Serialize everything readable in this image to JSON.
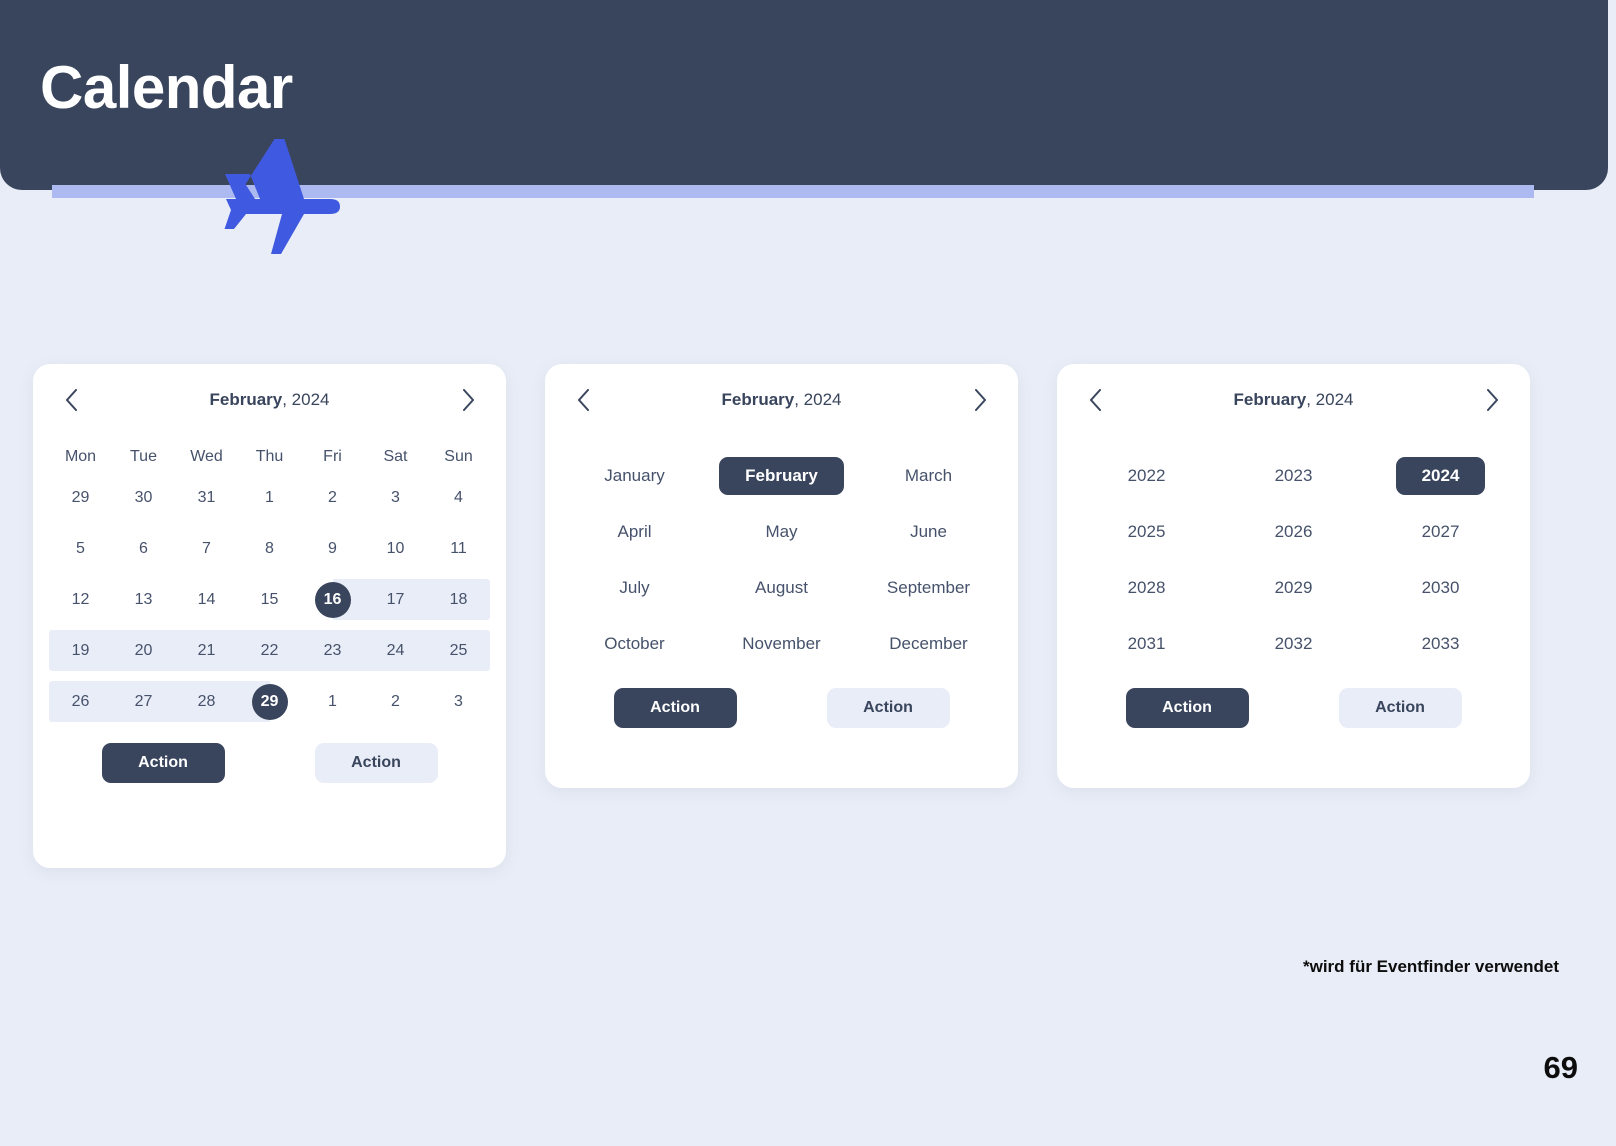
{
  "header": {
    "title": "Calendar",
    "bar_color": "#39455c",
    "accent_color": "#adbaf2",
    "plane_icon": "airplane-icon",
    "plane_color": "#3f5ae0"
  },
  "page": {
    "background": "#e9edf7",
    "footnote": "*wird für Eventfinder verwendet",
    "number": "69"
  },
  "common": {
    "prev_icon": "chevron-left-icon",
    "next_icon": "chevron-right-icon",
    "action_primary_label": "Action",
    "action_secondary_label": "Action",
    "accent_dark": "#39455c",
    "range_fill": "#e9edf7"
  },
  "day_picker": {
    "title_month": "February",
    "title_rest": ", 2024",
    "weekdays": [
      "Mon",
      "Tue",
      "Wed",
      "Thu",
      "Fri",
      "Sat",
      "Sun"
    ],
    "weeks": [
      [
        {
          "label": "29",
          "muted": true,
          "selected": false,
          "range": "none"
        },
        {
          "label": "30",
          "muted": true,
          "selected": false,
          "range": "none"
        },
        {
          "label": "31",
          "muted": true,
          "selected": false,
          "range": "none"
        },
        {
          "label": "1",
          "muted": false,
          "selected": false,
          "range": "none"
        },
        {
          "label": "2",
          "muted": false,
          "selected": false,
          "range": "none"
        },
        {
          "label": "3",
          "muted": false,
          "selected": false,
          "range": "none"
        },
        {
          "label": "4",
          "muted": false,
          "selected": false,
          "range": "none"
        }
      ],
      [
        {
          "label": "5",
          "muted": false,
          "selected": false,
          "range": "none"
        },
        {
          "label": "6",
          "muted": false,
          "selected": false,
          "range": "none"
        },
        {
          "label": "7",
          "muted": false,
          "selected": false,
          "range": "none"
        },
        {
          "label": "8",
          "muted": false,
          "selected": false,
          "range": "none"
        },
        {
          "label": "9",
          "muted": false,
          "selected": false,
          "range": "none"
        },
        {
          "label": "10",
          "muted": false,
          "selected": false,
          "range": "none"
        },
        {
          "label": "11",
          "muted": false,
          "selected": false,
          "range": "none"
        }
      ],
      [
        {
          "label": "12",
          "muted": false,
          "selected": false,
          "range": "none"
        },
        {
          "label": "13",
          "muted": false,
          "selected": false,
          "range": "none"
        },
        {
          "label": "14",
          "muted": false,
          "selected": false,
          "range": "none"
        },
        {
          "label": "15",
          "muted": false,
          "selected": false,
          "range": "none"
        },
        {
          "label": "16",
          "muted": false,
          "selected": true,
          "range": "start"
        },
        {
          "label": "17",
          "muted": false,
          "selected": false,
          "range": "in"
        },
        {
          "label": "18",
          "muted": false,
          "selected": false,
          "range": "in-end-row"
        }
      ],
      [
        {
          "label": "19",
          "muted": false,
          "selected": false,
          "range": "in-start-row"
        },
        {
          "label": "20",
          "muted": false,
          "selected": false,
          "range": "in"
        },
        {
          "label": "21",
          "muted": false,
          "selected": false,
          "range": "in"
        },
        {
          "label": "22",
          "muted": false,
          "selected": false,
          "range": "in"
        },
        {
          "label": "23",
          "muted": false,
          "selected": false,
          "range": "in"
        },
        {
          "label": "24",
          "muted": false,
          "selected": false,
          "range": "in"
        },
        {
          "label": "25",
          "muted": false,
          "selected": false,
          "range": "in-end-row"
        }
      ],
      [
        {
          "label": "26",
          "muted": false,
          "selected": false,
          "range": "in-start-row"
        },
        {
          "label": "27",
          "muted": false,
          "selected": false,
          "range": "in"
        },
        {
          "label": "28",
          "muted": false,
          "selected": false,
          "range": "in"
        },
        {
          "label": "29",
          "muted": false,
          "selected": true,
          "range": "end"
        },
        {
          "label": "1",
          "muted": true,
          "selected": false,
          "range": "none"
        },
        {
          "label": "2",
          "muted": true,
          "selected": false,
          "range": "none"
        },
        {
          "label": "3",
          "muted": true,
          "selected": false,
          "range": "none"
        }
      ]
    ],
    "selected_start": "16",
    "selected_end": "29"
  },
  "month_picker": {
    "title_month": "February",
    "title_rest": ", 2024",
    "months": [
      {
        "label": "January",
        "selected": false
      },
      {
        "label": "February",
        "selected": true
      },
      {
        "label": "March",
        "selected": false
      },
      {
        "label": "April",
        "selected": false
      },
      {
        "label": "May",
        "selected": false
      },
      {
        "label": "June",
        "selected": false
      },
      {
        "label": "July",
        "selected": false
      },
      {
        "label": "August",
        "selected": false
      },
      {
        "label": "September",
        "selected": false
      },
      {
        "label": "October",
        "selected": false
      },
      {
        "label": "November",
        "selected": false
      },
      {
        "label": "December",
        "selected": false
      }
    ]
  },
  "year_picker": {
    "title_month": "February",
    "title_rest": ", 2024",
    "years": [
      {
        "label": "2022",
        "selected": false
      },
      {
        "label": "2023",
        "selected": false
      },
      {
        "label": "2024",
        "selected": true
      },
      {
        "label": "2025",
        "selected": false
      },
      {
        "label": "2026",
        "selected": false
      },
      {
        "label": "2027",
        "selected": false
      },
      {
        "label": "2028",
        "selected": false
      },
      {
        "label": "2029",
        "selected": false
      },
      {
        "label": "2030",
        "selected": false
      },
      {
        "label": "2031",
        "selected": false
      },
      {
        "label": "2032",
        "selected": false
      },
      {
        "label": "2033",
        "selected": false
      }
    ]
  }
}
